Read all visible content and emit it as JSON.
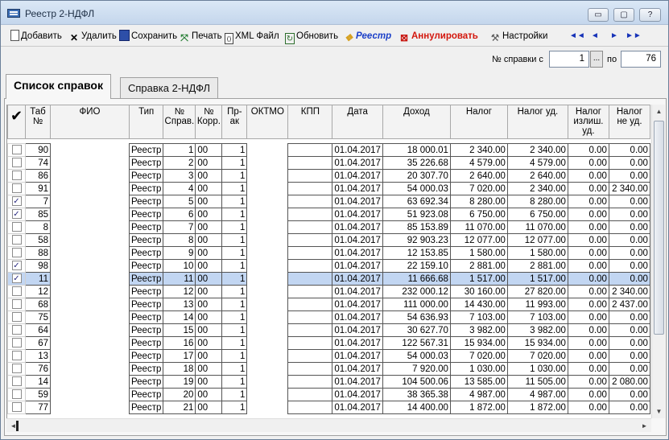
{
  "window": {
    "title": "Реестр 2-НДФЛ",
    "min_btn": "▭",
    "max_btn": "▢",
    "close_btn": "?"
  },
  "toolbar": {
    "add": "Добавить",
    "delete": "Удалить",
    "save": "Сохранить",
    "print": "Печать",
    "xml": "XML Файл",
    "refresh": "Обновить",
    "registry": "Реестр",
    "annul": "Аннулировать",
    "settings": "Настройки",
    "nav_first": "◄◄",
    "nav_prev": "◄",
    "nav_next": "►",
    "nav_last": "►►"
  },
  "range": {
    "from_label": "№ справки с",
    "from_value": "1",
    "ellipsis": "...",
    "to_label": "по",
    "to_value": "76"
  },
  "tabs": [
    "Список справок",
    "Справка 2-НДФЛ"
  ],
  "columns": [
    "✔",
    "Таб №",
    "ФИО",
    "Тип",
    "№ Справ.",
    "№ Корр.",
    "Пр-ак",
    "ОКТМО",
    "КПП",
    "Дата",
    "Доход",
    "Налог",
    "Налог уд.",
    "Налог излиш. уд.",
    "Налог не уд."
  ],
  "rows": [
    {
      "checked": false,
      "tab": "90",
      "type": "Реестр",
      "num": "1",
      "corr": "00",
      "pr": "1",
      "date": "01.04.2017",
      "income": "18 000.01",
      "tax": "2 340.00",
      "tax_ud": "2 340.00",
      "excess": "0.00",
      "not_ud": "0.00"
    },
    {
      "checked": false,
      "tab": "74",
      "type": "Реестр",
      "num": "2",
      "corr": "00",
      "pr": "1",
      "date": "01.04.2017",
      "income": "35 226.68",
      "tax": "4 579.00",
      "tax_ud": "4 579.00",
      "excess": "0.00",
      "not_ud": "0.00"
    },
    {
      "checked": false,
      "tab": "86",
      "type": "Реестр",
      "num": "3",
      "corr": "00",
      "pr": "1",
      "date": "01.04.2017",
      "income": "20 307.70",
      "tax": "2 640.00",
      "tax_ud": "2 640.00",
      "excess": "0.00",
      "not_ud": "0.00"
    },
    {
      "checked": false,
      "tab": "91",
      "type": "Реестр",
      "num": "4",
      "corr": "00",
      "pr": "1",
      "date": "01.04.2017",
      "income": "54 000.03",
      "tax": "7 020.00",
      "tax_ud": "2 340.00",
      "excess": "0.00",
      "not_ud": "2 340.00"
    },
    {
      "checked": true,
      "tab": "7",
      "type": "Реестр",
      "num": "5",
      "corr": "00",
      "pr": "1",
      "date": "01.04.2017",
      "income": "63 692.34",
      "tax": "8 280.00",
      "tax_ud": "8 280.00",
      "excess": "0.00",
      "not_ud": "0.00"
    },
    {
      "checked": true,
      "tab": "85",
      "type": "Реестр",
      "num": "6",
      "corr": "00",
      "pr": "1",
      "date": "01.04.2017",
      "income": "51 923.08",
      "tax": "6 750.00",
      "tax_ud": "6 750.00",
      "excess": "0.00",
      "not_ud": "0.00"
    },
    {
      "checked": false,
      "tab": "8",
      "type": "Реестр",
      "num": "7",
      "corr": "00",
      "pr": "1",
      "date": "01.04.2017",
      "income": "85 153.89",
      "tax": "11 070.00",
      "tax_ud": "11 070.00",
      "excess": "0.00",
      "not_ud": "0.00"
    },
    {
      "checked": false,
      "tab": "58",
      "type": "Реестр",
      "num": "8",
      "corr": "00",
      "pr": "1",
      "date": "01.04.2017",
      "income": "92 903.23",
      "tax": "12 077.00",
      "tax_ud": "12 077.00",
      "excess": "0.00",
      "not_ud": "0.00"
    },
    {
      "checked": false,
      "tab": "88",
      "type": "Реестр",
      "num": "9",
      "corr": "00",
      "pr": "1",
      "date": "01.04.2017",
      "income": "12 153.85",
      "tax": "1 580.00",
      "tax_ud": "1 580.00",
      "excess": "0.00",
      "not_ud": "0.00"
    },
    {
      "checked": true,
      "tab": "98",
      "type": "Реестр",
      "num": "10",
      "corr": "00",
      "pr": "1",
      "date": "01.04.2017",
      "income": "22 159.10",
      "tax": "2 881.00",
      "tax_ud": "2 881.00",
      "excess": "0.00",
      "not_ud": "0.00"
    },
    {
      "checked": true,
      "tab": "11",
      "type": "Реестр",
      "num": "11",
      "corr": "00",
      "pr": "1",
      "date": "01.04.2017",
      "income": "11 666.68",
      "tax": "1 517.00",
      "tax_ud": "1 517.00",
      "excess": "0.00",
      "not_ud": "0.00",
      "selected": true
    },
    {
      "checked": false,
      "tab": "12",
      "type": "Реестр",
      "num": "12",
      "corr": "00",
      "pr": "1",
      "date": "01.04.2017",
      "income": "232 000.12",
      "tax": "30 160.00",
      "tax_ud": "27 820.00",
      "excess": "0.00",
      "not_ud": "2 340.00"
    },
    {
      "checked": false,
      "tab": "68",
      "type": "Реестр",
      "num": "13",
      "corr": "00",
      "pr": "1",
      "date": "01.04.2017",
      "income": "111 000.00",
      "tax": "14 430.00",
      "tax_ud": "11 993.00",
      "excess": "0.00",
      "not_ud": "2 437.00"
    },
    {
      "checked": false,
      "tab": "75",
      "type": "Реестр",
      "num": "14",
      "corr": "00",
      "pr": "1",
      "date": "01.04.2017",
      "income": "54 636.93",
      "tax": "7 103.00",
      "tax_ud": "7 103.00",
      "excess": "0.00",
      "not_ud": "0.00"
    },
    {
      "checked": false,
      "tab": "64",
      "type": "Реестр",
      "num": "15",
      "corr": "00",
      "pr": "1",
      "date": "01.04.2017",
      "income": "30 627.70",
      "tax": "3 982.00",
      "tax_ud": "3 982.00",
      "excess": "0.00",
      "not_ud": "0.00"
    },
    {
      "checked": false,
      "tab": "67",
      "type": "Реестр",
      "num": "16",
      "corr": "00",
      "pr": "1",
      "date": "01.04.2017",
      "income": "122 567.31",
      "tax": "15 934.00",
      "tax_ud": "15 934.00",
      "excess": "0.00",
      "not_ud": "0.00"
    },
    {
      "checked": false,
      "tab": "13",
      "type": "Реестр",
      "num": "17",
      "corr": "00",
      "pr": "1",
      "date": "01.04.2017",
      "income": "54 000.03",
      "tax": "7 020.00",
      "tax_ud": "7 020.00",
      "excess": "0.00",
      "not_ud": "0.00"
    },
    {
      "checked": false,
      "tab": "76",
      "type": "Реестр",
      "num": "18",
      "corr": "00",
      "pr": "1",
      "date": "01.04.2017",
      "income": "7 920.00",
      "tax": "1 030.00",
      "tax_ud": "1 030.00",
      "excess": "0.00",
      "not_ud": "0.00"
    },
    {
      "checked": false,
      "tab": "14",
      "type": "Реестр",
      "num": "19",
      "corr": "00",
      "pr": "1",
      "date": "01.04.2017",
      "income": "104 500.06",
      "tax": "13 585.00",
      "tax_ud": "11 505.00",
      "excess": "0.00",
      "not_ud": "2 080.00"
    },
    {
      "checked": false,
      "tab": "59",
      "type": "Реестр",
      "num": "20",
      "corr": "00",
      "pr": "1",
      "date": "01.04.2017",
      "income": "38 365.38",
      "tax": "4 987.00",
      "tax_ud": "4 987.00",
      "excess": "0.00",
      "not_ud": "0.00"
    },
    {
      "checked": false,
      "tab": "77",
      "type": "Реестр",
      "num": "21",
      "corr": "00",
      "pr": "1",
      "date": "01.04.2017",
      "income": "14 400.00",
      "tax": "1 872.00",
      "tax_ud": "1 872.00",
      "excess": "0.00",
      "not_ud": "0.00"
    }
  ],
  "colors": {
    "selected_row": "#c2d6f2",
    "registry_text": "#1c40c8",
    "annul_text": "#d3160c"
  },
  "icons": [
    "page-icon",
    "x-icon",
    "disk-icon",
    "print-icon",
    "xml-icon",
    "refresh-icon",
    "registry-icon",
    "annul-icon",
    "tools-icon"
  ]
}
